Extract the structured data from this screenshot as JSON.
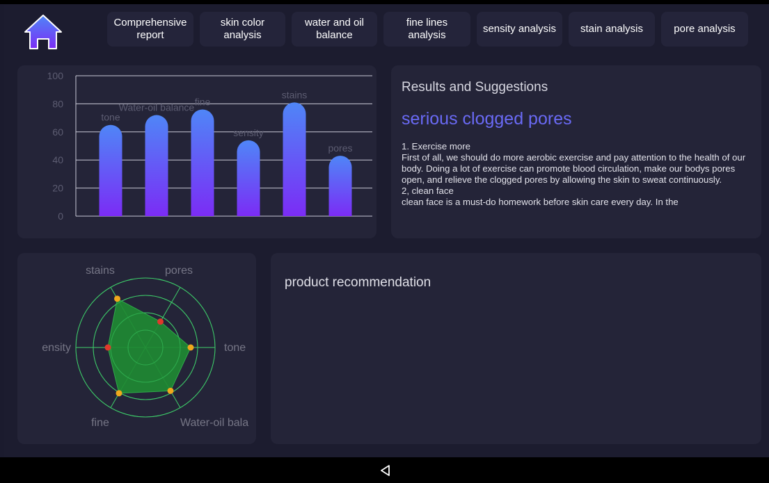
{
  "tabs": [
    {
      "label": "Comprehensive\nreport",
      "active": true
    },
    {
      "label": "skin color\nanalysis",
      "active": false
    },
    {
      "label": "water and oil\nbalance",
      "active": false
    },
    {
      "label": "fine lines\nanalysis",
      "active": false
    },
    {
      "label": "sensity analysis",
      "active": false
    },
    {
      "label": "stain analysis",
      "active": false
    },
    {
      "label": "pore analysis",
      "active": false
    }
  ],
  "icons": {
    "home": "home-icon",
    "back": "back-triangle-icon"
  },
  "colors": {
    "accent_start": "#5d8cf4",
    "accent_end": "#7a55f0",
    "bar_top": "#4f86f7",
    "bar_bottom": "#7b2cf5",
    "radar_fill": "#1f8a33",
    "radar_line": "#3fcf6a",
    "dot_orange": "#f0a81c",
    "dot_red": "#e0392b"
  },
  "chart_data": [
    {
      "type": "bar",
      "categories": [
        "tone",
        "Water-oil balance",
        "fine",
        "sensity",
        "stains",
        "pores"
      ],
      "values": [
        65,
        72,
        76,
        54,
        81,
        43
      ],
      "ylim": [
        0,
        100
      ],
      "yticks": [
        0,
        20,
        40,
        60,
        80,
        100
      ],
      "grid": true
    },
    {
      "type": "radar",
      "axes": [
        "tone",
        "Water-oil balance",
        "fine",
        "sensity",
        "stains",
        "pores"
      ],
      "axis_labels_shown": [
        "tone",
        "Water-oil bala",
        "fine",
        "ensity",
        "stains",
        "pores"
      ],
      "values": [
        65,
        72,
        76,
        54,
        81,
        43
      ],
      "max": 100,
      "dot_colors": [
        "orange",
        "orange",
        "orange",
        "red",
        "orange",
        "red"
      ]
    }
  ],
  "results": {
    "title": "Results and Suggestions",
    "headline": "serious clogged pores",
    "body": "1. Exercise more\nFirst of all, we should do more aerobic exercise and pay attention to the health of our body. Doing a lot of exercise can promote blood circulation, make our bodys pores open, and relieve the clogged pores by allowing the skin to sweat continuously.\n2, clean face\n clean face is a must-do homework before skin care every day. In the"
  },
  "product": {
    "title": "product recommendation"
  }
}
